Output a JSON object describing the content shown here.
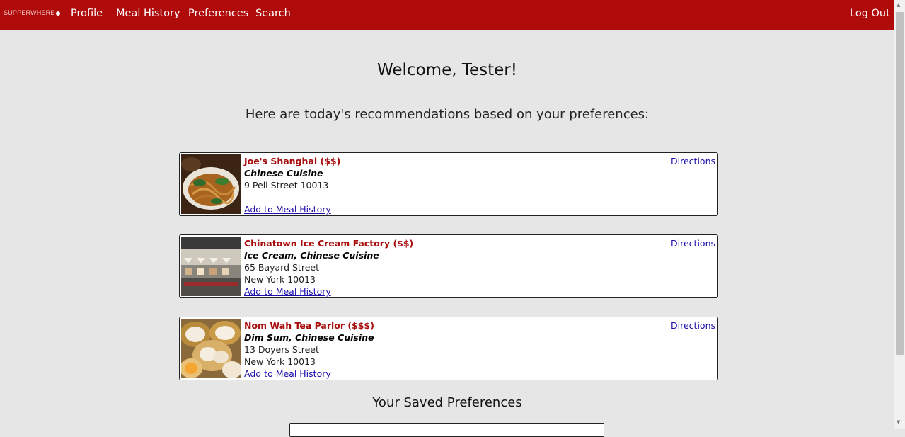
{
  "nav": {
    "brand": "SUPPERWHERE",
    "links": [
      "Profile",
      "Meal History",
      "Preferences",
      "Search"
    ],
    "logout": "Log Out",
    "bg_color": "#b00b0b"
  },
  "welcome": "Welcome, Tester!",
  "subtitle": "Here are today's recommendations based on your preferences:",
  "restaurants": [
    {
      "name": "Joe's Shanghai ($$)",
      "cuisine": "Chinese Cuisine",
      "address1": "9 Pell Street 10013",
      "address2": "",
      "add_label": "Add to Meal History",
      "directions": "Directions",
      "image": "noodles-photo"
    },
    {
      "name": "Chinatown Ice Cream Factory ($$)",
      "cuisine": "Ice Cream, Chinese Cuisine",
      "address1": "65 Bayard Street",
      "address2": "New York 10013",
      "add_label": "Add to Meal History",
      "directions": "Directions",
      "image": "storefront-photo"
    },
    {
      "name": "Nom Wah Tea Parlor ($$$)",
      "cuisine": "Dim Sum, Chinese Cuisine",
      "address1": "13 Doyers Street",
      "address2": "New York 10013",
      "add_label": "Add to Meal History",
      "directions": "Directions",
      "image": "dumplings-photo"
    }
  ],
  "saved_title": "Your Saved Preferences",
  "accent_color": "#a80c0c",
  "link_color": "#1a0dab"
}
